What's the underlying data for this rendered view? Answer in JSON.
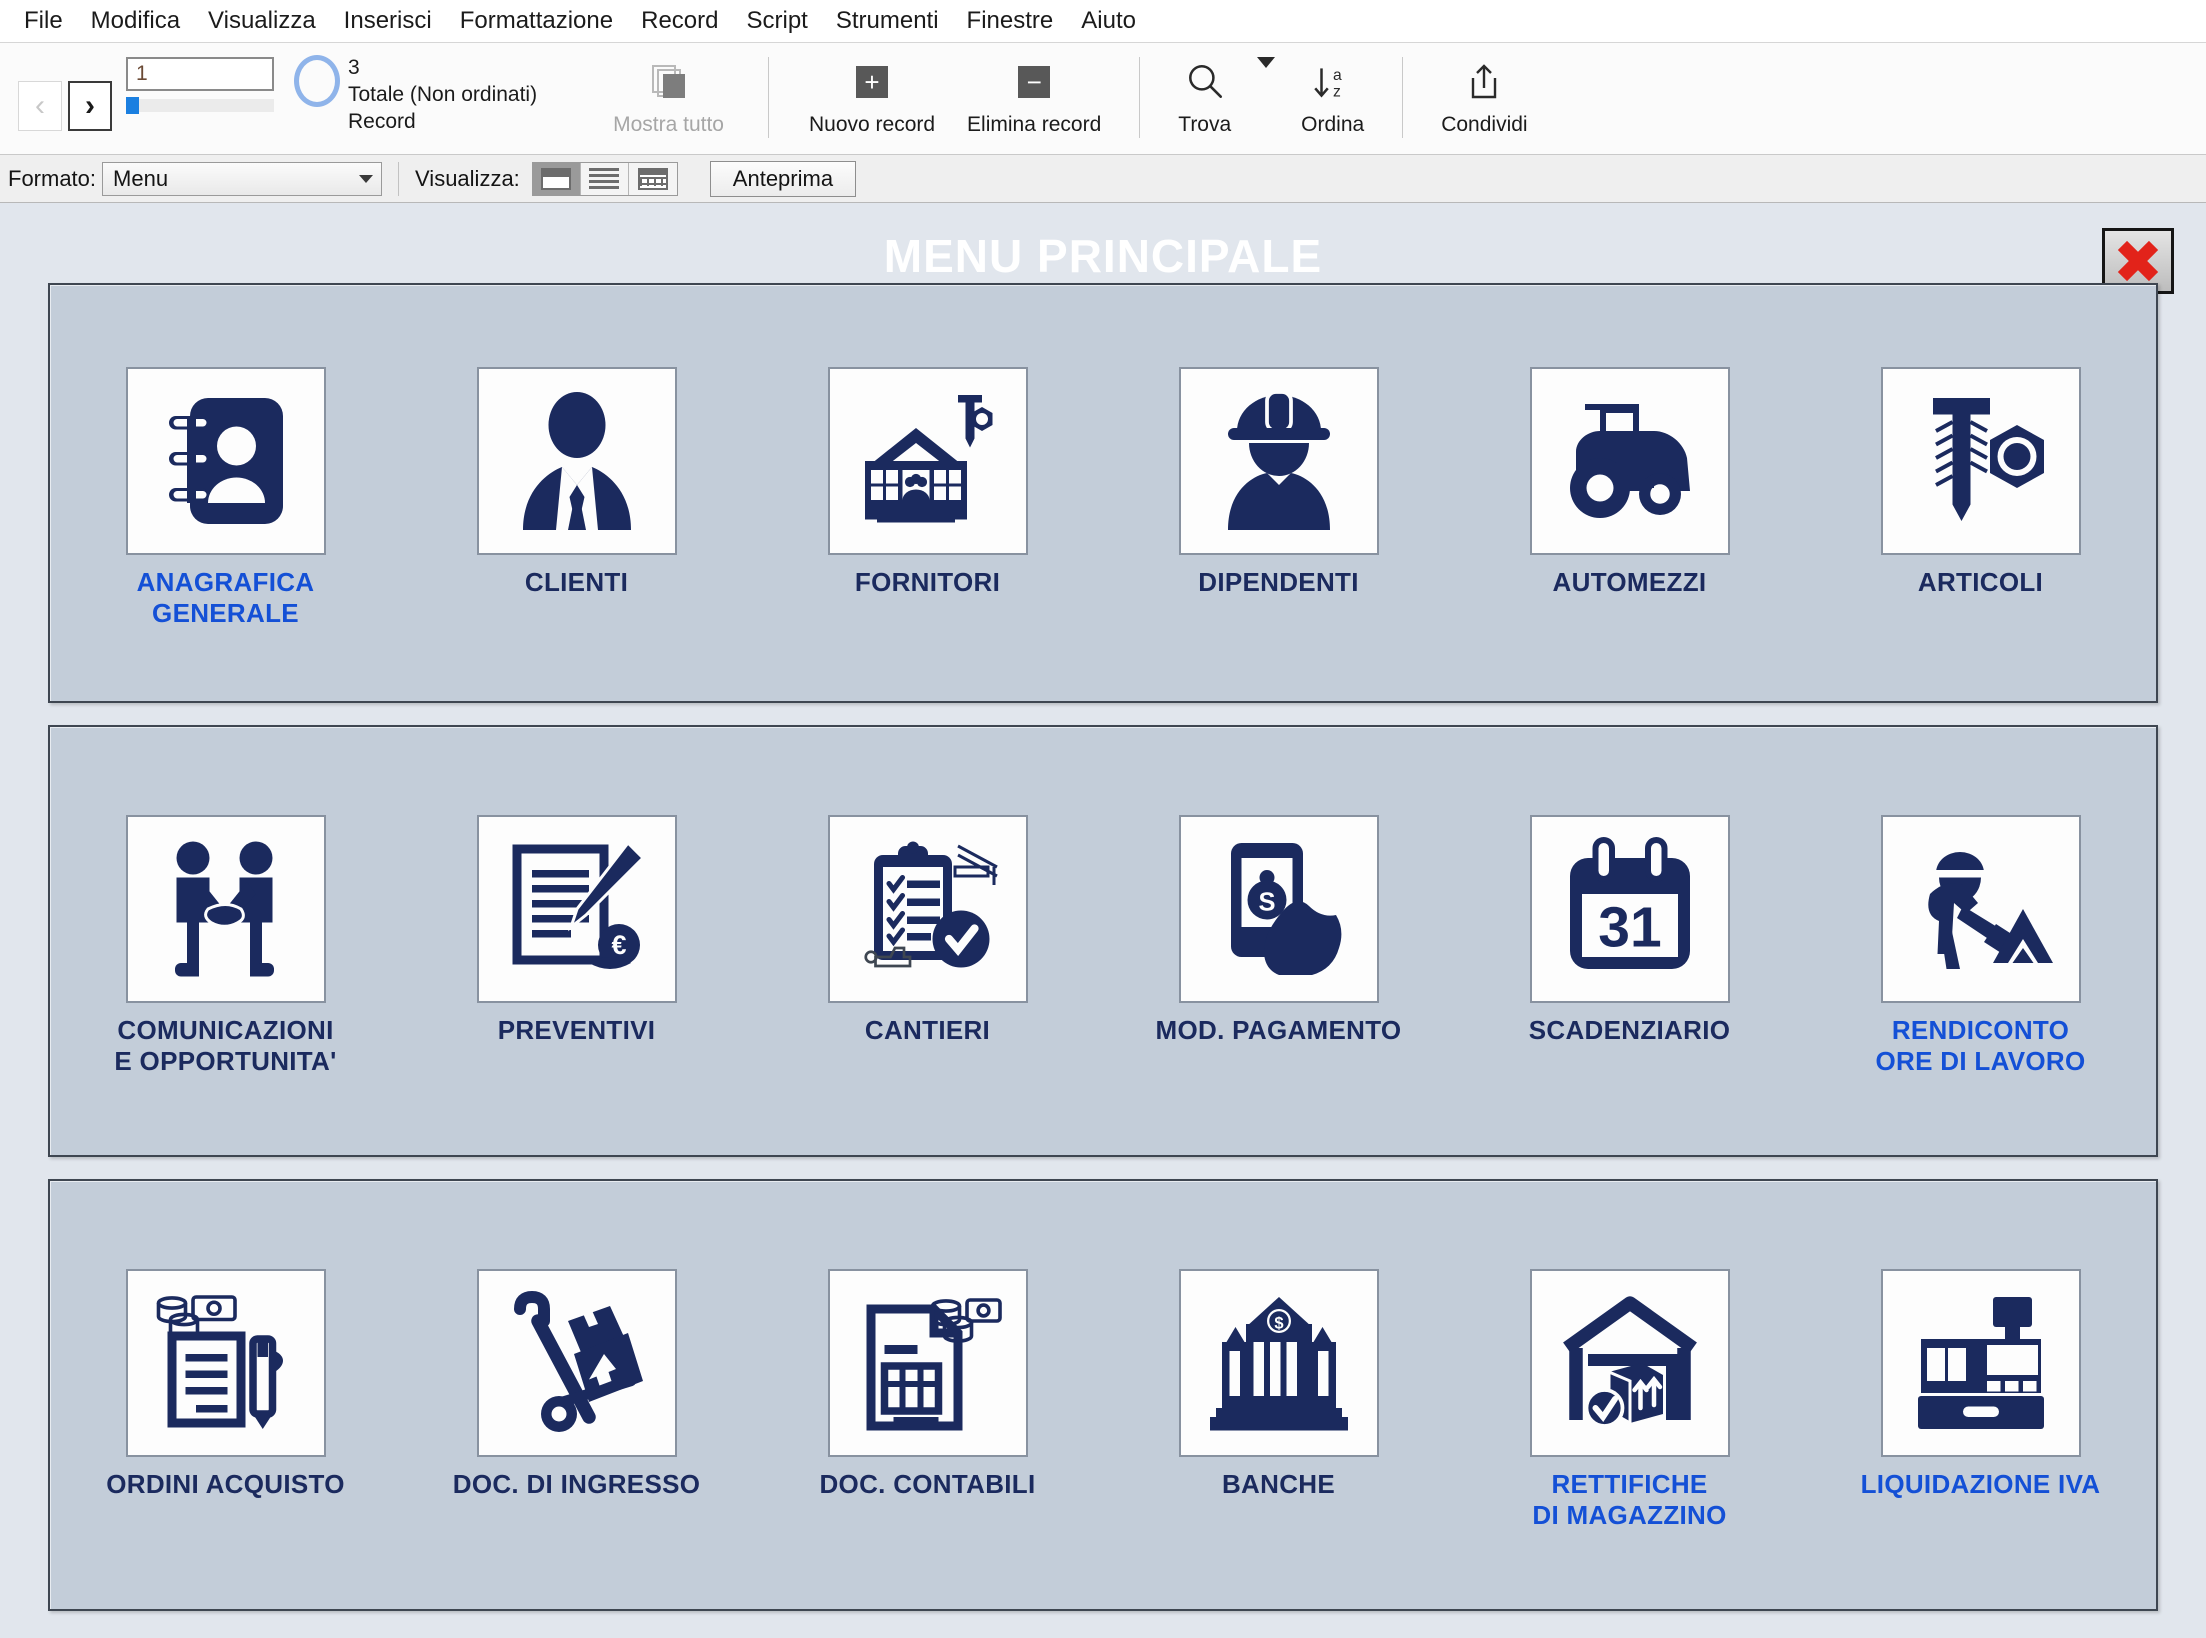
{
  "menubar": {
    "items": [
      {
        "label": "File"
      },
      {
        "label": "Modifica"
      },
      {
        "label": "Visualizza"
      },
      {
        "label": "Inserisci"
      },
      {
        "label": "Formattazione"
      },
      {
        "label": "Record"
      },
      {
        "label": "Script"
      },
      {
        "label": "Strumenti"
      },
      {
        "label": "Finestre"
      },
      {
        "label": "Aiuto"
      }
    ]
  },
  "toolbar": {
    "prev_arrow": "‹",
    "next_arrow": "›",
    "record_number": "1",
    "record_total": "3",
    "record_sort_status": "Totale (Non ordinati)",
    "record_word": "Record",
    "show_all_label": "Mostra tutto",
    "new_record_label": "Nuovo record",
    "new_record_glyph": "+",
    "delete_record_label": "Elimina record",
    "delete_record_glyph": "−",
    "find_label": "Trova",
    "sort_label": "Ordina",
    "sort_glyph": "↓",
    "sort_letters_top": "a",
    "sort_letters_bottom": "z",
    "share_label": "Condividi"
  },
  "formatbar": {
    "format_label": "Formato:",
    "format_value": "Menu",
    "view_label": "Visualizza:",
    "view_modes": [
      "form-view",
      "list-view",
      "table-view"
    ],
    "selected_view": "form-view",
    "preview_button": "Anteprima"
  },
  "content": {
    "title": "MENU PRINCIPALE",
    "close_button_tooltip": "Chiudi",
    "colors": {
      "page_background": "#e1e6ed",
      "panel_background": "#c3cdd9",
      "panel_border": "#3e4651",
      "icon_navy": "#1b2a5e",
      "label_dark": "#1b2a5e",
      "label_blue": "#1450d6",
      "close_red": "#e2231a"
    },
    "panels": [
      {
        "id": "panel-anagrafiche",
        "tiles": [
          {
            "label": "ANAGRAFICA\nGENERALE",
            "icon": "address-book-icon",
            "label_color": "blue"
          },
          {
            "label": "CLIENTI",
            "icon": "businessman-icon",
            "label_color": "dark"
          },
          {
            "label": "FORNITORI",
            "icon": "warehouse-screw-icon",
            "label_color": "dark"
          },
          {
            "label": "DIPENDENTI",
            "icon": "worker-helmet-icon",
            "label_color": "dark"
          },
          {
            "label": "AUTOMEZZI",
            "icon": "tractor-icon",
            "label_color": "dark"
          },
          {
            "label": "ARTICOLI",
            "icon": "screw-nut-icon",
            "label_color": "dark"
          }
        ]
      },
      {
        "id": "panel-operativo",
        "tiles": [
          {
            "label": "COMUNICAZIONI\nE OPPORTUNITA'",
            "icon": "handshake-icon",
            "label_color": "dark"
          },
          {
            "label": "PREVENTIVI",
            "icon": "document-pencil-euro-icon",
            "label_color": "dark"
          },
          {
            "label": "CANTIERI",
            "icon": "clipboard-check-crane-icon",
            "label_color": "dark"
          },
          {
            "label": "MOD. PAGAMENTO",
            "icon": "mobile-payment-icon",
            "label_color": "dark"
          },
          {
            "label": "SCADENZIARIO",
            "icon": "calendar-31-icon",
            "label_color": "dark"
          },
          {
            "label": "RENDICONTO\nORE DI LAVORO",
            "icon": "worker-shovel-icon",
            "label_color": "blue"
          }
        ]
      },
      {
        "id": "panel-documenti",
        "tiles": [
          {
            "label": "ORDINI ACQUISTO",
            "icon": "order-pen-money-icon",
            "label_color": "dark"
          },
          {
            "label": "DOC. DI INGRESSO",
            "icon": "hand-truck-box-icon",
            "label_color": "dark"
          },
          {
            "label": "DOC. CONTABILI",
            "icon": "invoice-money-icon",
            "label_color": "dark"
          },
          {
            "label": "BANCHE",
            "icon": "bank-building-icon",
            "label_color": "dark"
          },
          {
            "label": "RETTIFICHE\nDI MAGAZZINO",
            "icon": "warehouse-check-icon",
            "label_color": "blue"
          },
          {
            "label": "LIQUIDAZIONE IVA",
            "icon": "cash-register-icon",
            "label_color": "blue"
          }
        ]
      }
    ]
  }
}
